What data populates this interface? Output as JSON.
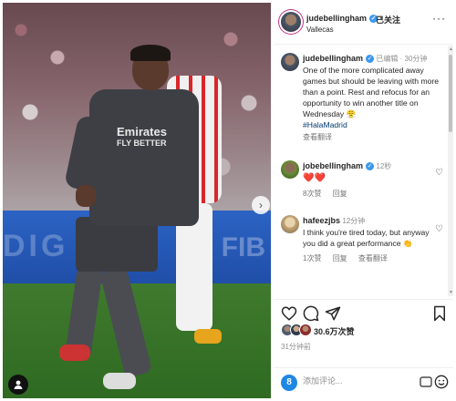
{
  "post": {
    "username": "judebellingham",
    "follow_state": "已关注",
    "location": "Vallecas",
    "more": "···"
  },
  "caption": {
    "username": "judebellingham",
    "meta": "已编辑 · 30分钟",
    "text": "One of the more complicated away games but should be leaving with more than a point. Rest and refocus for an opportunity to win another title on Wednesday 😤",
    "hashtag": "#HalaMadrid",
    "translate": "查看翻译"
  },
  "comments": [
    {
      "username": "jobebellingham",
      "time": "12秒",
      "text": "❤️❤️",
      "likes": "8次赞",
      "reply": "回复"
    },
    {
      "username": "hafeezjbs",
      "time": "12分钟",
      "text": "I think you're tired today, but anyway you did a great performance 👏",
      "likes": "1次赞",
      "reply": "回复",
      "translate": "查看翻译"
    }
  ],
  "likes": {
    "count": "30.6万次赞",
    "time_ago": "31分钟前"
  },
  "add_comment": {
    "placeholder": "添加评论...",
    "gif": "GIF"
  },
  "photo": {
    "sponsor_line1": "Emirates",
    "sponsor_line2": "FLY BETTER"
  },
  "icons": {
    "verified": "verified-badge-icon",
    "heart": "heart-icon",
    "comment": "comment-icon",
    "share": "send-icon",
    "save": "bookmark-icon",
    "next": "chevron-right-icon",
    "tag": "person-tag-icon"
  },
  "colors": {
    "verified_blue": "#3897f0",
    "hashtag": "#00376b",
    "like_red": "#ed4956"
  }
}
